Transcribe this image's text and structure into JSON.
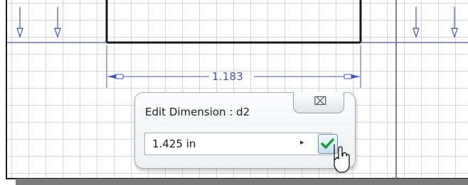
{
  "dimension": {
    "value_label": "1.183"
  },
  "edit_dialog": {
    "title": "Edit Dimension : d2",
    "value": "1.425 in",
    "expand_arrow": "▸",
    "close_symbol": "⌧"
  },
  "icons": {
    "close": "close-icon",
    "accept": "checkmark-icon",
    "expand": "arrow-right-icon",
    "cursor": "mouse-pointer-icon"
  },
  "colors": {
    "dimension_blue": "#3d55c8",
    "geometry_black": "#1a1a1a",
    "grid": "#d4d7dc",
    "accept_green": "#1e9a3b"
  }
}
